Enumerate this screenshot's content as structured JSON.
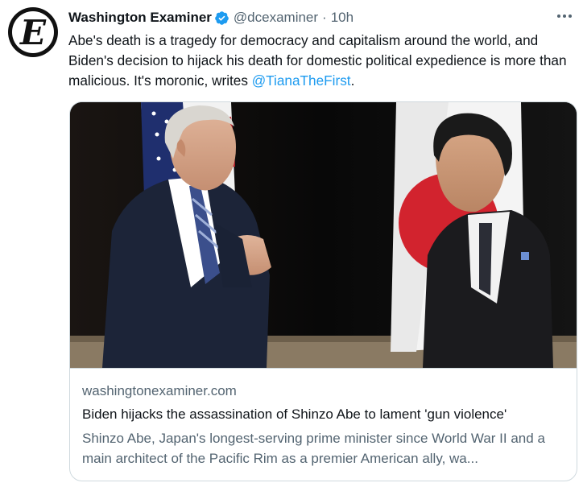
{
  "author": {
    "name": "Washington Examiner",
    "handle": "@dcexaminer",
    "separator": "·",
    "time": "10h",
    "avatar_letter": "E",
    "verified_color": "#1d9bf0"
  },
  "tweet": {
    "text_before": "Abe's death is a tragedy for democracy and capitalism around the world, and Biden's decision to hijack his death for domestic political expedience is more than malicious. It's moronic, writes ",
    "mention": "@TianaTheFirst",
    "text_after": "."
  },
  "card": {
    "domain": "washingtonexaminer.com",
    "title": "Biden hijacks the assassination of Shinzo Abe to lament 'gun violence'",
    "description": "Shinzo Abe, Japan's longest-serving prime minister since World War II and a main architect of the Pacific Rim as a premier American ally, wa..."
  },
  "icons": {
    "more": "more-options-icon",
    "verified": "verified-badge-icon"
  },
  "colors": {
    "link": "#1d9bf0",
    "secondary_text": "#536471",
    "border": "#cfd9de"
  }
}
